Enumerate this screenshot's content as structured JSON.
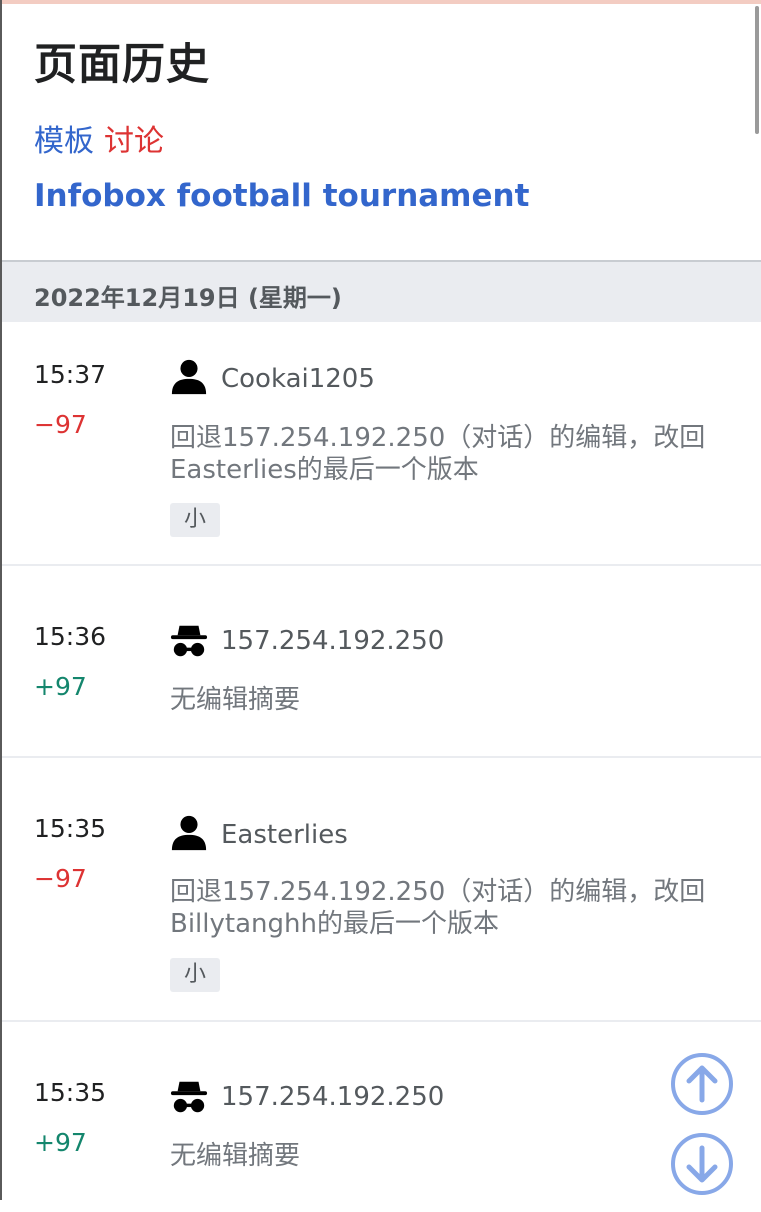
{
  "page": {
    "title": "页面历史",
    "namespace_tabs": [
      {
        "label": "模板",
        "color": "#3366cc"
      },
      {
        "label": "讨论",
        "color": "#dd3333"
      }
    ],
    "page_name": "Infobox football tournament"
  },
  "history": {
    "date_header": "2022年12月19日 (星期一)",
    "entries": [
      {
        "time": "15:37",
        "diff": "−97",
        "diff_sign": "negative",
        "user": "Cookai1205",
        "user_type": "registered",
        "user_icon": "user-icon",
        "summary": "回退157.254.192.250（对话）的编辑，改回Easterlies的最后一个版本",
        "minor_badge": "小"
      },
      {
        "time": "15:36",
        "diff": "+97",
        "diff_sign": "positive",
        "user": "157.254.192.250",
        "user_type": "anonymous",
        "user_icon": "anonymous-user-icon",
        "summary": "无编辑摘要"
      },
      {
        "time": "15:35",
        "diff": "−97",
        "diff_sign": "negative",
        "user": "Easterlies",
        "user_type": "registered",
        "user_icon": "user-icon",
        "summary": "回退157.254.192.250（对话）的编辑，改回Billytanghh的最后一个版本",
        "minor_badge": "小"
      },
      {
        "time": "15:35",
        "diff": "+97",
        "diff_sign": "positive",
        "user": "157.254.192.250",
        "user_type": "anonymous",
        "user_icon": "anonymous-user-icon",
        "summary": "无编辑摘要"
      }
    ]
  },
  "floating_nav": {
    "up_icon": "arrow-up-circle-icon",
    "down_icon": "arrow-down-circle-icon",
    "color": "#88a8e8"
  },
  "colors": {
    "link": "#3366cc",
    "talk": "#dd3333",
    "negative_diff": "#dd3333",
    "positive_diff": "#14866d",
    "date_header_bg": "#eaecf0"
  }
}
